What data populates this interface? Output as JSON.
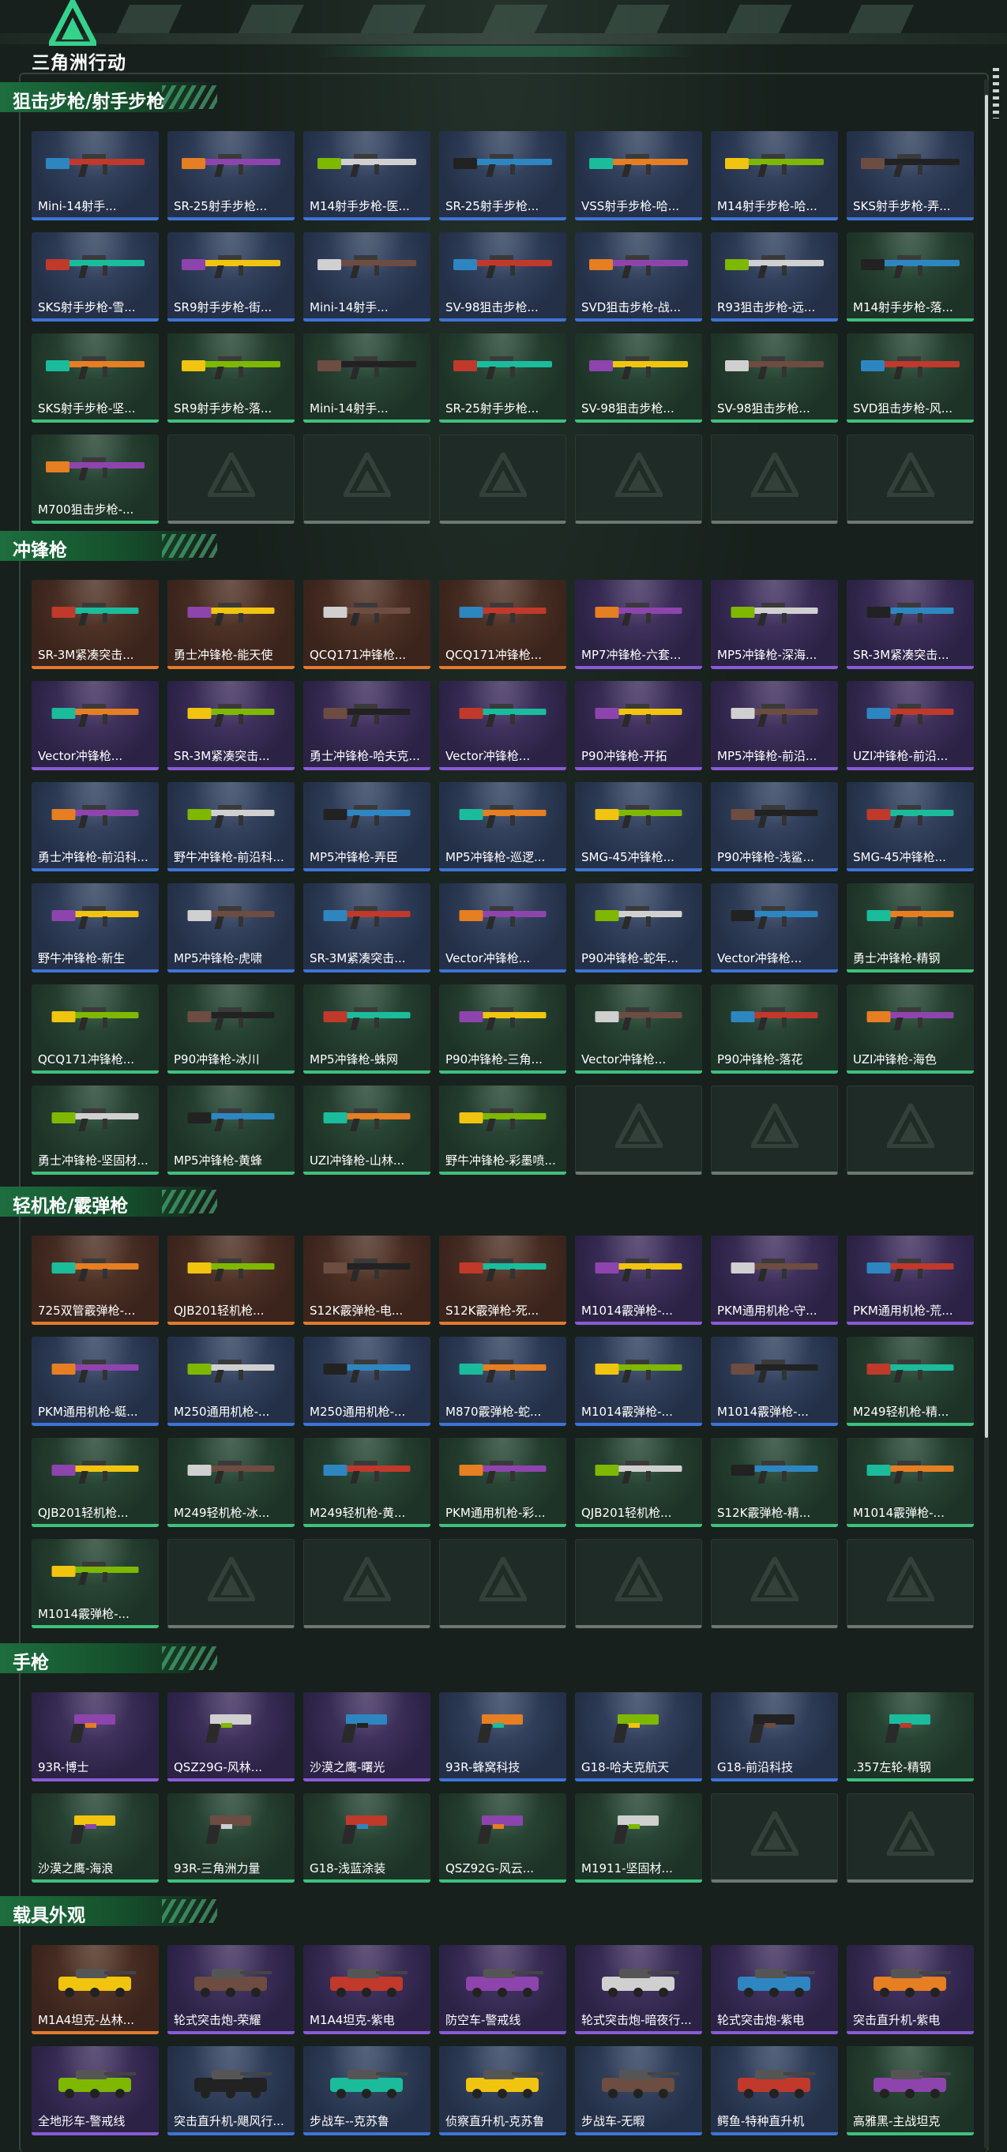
{
  "app": {
    "title": "三角洲行动"
  },
  "colors": {
    "blue": "#3e74d6",
    "purple": "#8a5ad6",
    "orange": "#e27a2e",
    "green": "#3fc07e",
    "accent": "#1d6e3e"
  },
  "categories": [
    {
      "title": "狙击步枪/射手步枪",
      "kind": "gun",
      "items": [
        {
          "label": "Mini-14射手...",
          "rarity": "blue"
        },
        {
          "label": "SR-25射手步枪...",
          "rarity": "blue"
        },
        {
          "label": "M14射手步枪-医...",
          "rarity": "blue"
        },
        {
          "label": "SR-25射手步枪...",
          "rarity": "blue"
        },
        {
          "label": "VSS射手步枪-哈...",
          "rarity": "blue"
        },
        {
          "label": "M14射手步枪-哈...",
          "rarity": "blue"
        },
        {
          "label": "SKS射手步枪-弄...",
          "rarity": "blue"
        },
        {
          "label": "SKS射手步枪-雪...",
          "rarity": "blue"
        },
        {
          "label": "SR9射手步枪-街...",
          "rarity": "blue"
        },
        {
          "label": "Mini-14射手...",
          "rarity": "blue"
        },
        {
          "label": "SV-98狙击步枪...",
          "rarity": "blue"
        },
        {
          "label": "SVD狙击步枪-战...",
          "rarity": "blue"
        },
        {
          "label": "R93狙击步枪-远...",
          "rarity": "blue"
        },
        {
          "label": "M14射手步枪-落...",
          "rarity": "green"
        },
        {
          "label": "SKS射手步枪-坚...",
          "rarity": "green"
        },
        {
          "label": "SR9射手步枪-落...",
          "rarity": "green"
        },
        {
          "label": "Mini-14射手...",
          "rarity": "green"
        },
        {
          "label": "SR-25射手步枪...",
          "rarity": "green"
        },
        {
          "label": "SV-98狙击步枪...",
          "rarity": "green"
        },
        {
          "label": "SV-98狙击步枪...",
          "rarity": "green"
        },
        {
          "label": "SVD狙击步枪-风...",
          "rarity": "green"
        },
        {
          "label": "M700狙击步枪-...",
          "rarity": "green"
        },
        {
          "label": "",
          "rarity": "empty"
        },
        {
          "label": "",
          "rarity": "empty"
        },
        {
          "label": "",
          "rarity": "empty"
        },
        {
          "label": "",
          "rarity": "empty"
        },
        {
          "label": "",
          "rarity": "empty"
        },
        {
          "label": "",
          "rarity": "empty"
        }
      ]
    },
    {
      "title": "冲锋枪",
      "kind": "smg",
      "items": [
        {
          "label": "SR-3M紧凑突击...",
          "rarity": "orange"
        },
        {
          "label": "勇士冲锋枪-能天使",
          "rarity": "orange"
        },
        {
          "label": "QCQ171冲锋枪...",
          "rarity": "orange"
        },
        {
          "label": "QCQ171冲锋枪...",
          "rarity": "orange"
        },
        {
          "label": "MP7冲锋枪-六套...",
          "rarity": "purple"
        },
        {
          "label": "MP5冲锋枪-深海...",
          "rarity": "purple"
        },
        {
          "label": "SR-3M紧凑突击...",
          "rarity": "purple"
        },
        {
          "label": "Vector冲锋枪...",
          "rarity": "purple"
        },
        {
          "label": "SR-3M紧凑突击...",
          "rarity": "purple"
        },
        {
          "label": "勇士冲锋枪-哈夫克...",
          "rarity": "purple"
        },
        {
          "label": "Vector冲锋枪...",
          "rarity": "purple"
        },
        {
          "label": "P90冲锋枪-开拓",
          "rarity": "purple"
        },
        {
          "label": "MP5冲锋枪-前沿...",
          "rarity": "purple"
        },
        {
          "label": "UZI冲锋枪-前沿...",
          "rarity": "purple"
        },
        {
          "label": "勇士冲锋枪-前沿科...",
          "rarity": "blue"
        },
        {
          "label": "野牛冲锋枪-前沿科...",
          "rarity": "blue"
        },
        {
          "label": "MP5冲锋枪-弄臣",
          "rarity": "blue"
        },
        {
          "label": "MP5冲锋枪-巡逻...",
          "rarity": "blue"
        },
        {
          "label": "SMG-45冲锋枪...",
          "rarity": "blue"
        },
        {
          "label": "P90冲锋枪-浅鲨...",
          "rarity": "blue"
        },
        {
          "label": "SMG-45冲锋枪...",
          "rarity": "blue"
        },
        {
          "label": "野牛冲锋枪-新生",
          "rarity": "blue"
        },
        {
          "label": "MP5冲锋枪-虎啸",
          "rarity": "blue"
        },
        {
          "label": "SR-3M紧凑突击...",
          "rarity": "blue"
        },
        {
          "label": "Vector冲锋枪...",
          "rarity": "blue"
        },
        {
          "label": "P90冲锋枪-蛇年...",
          "rarity": "blue"
        },
        {
          "label": "Vector冲锋枪...",
          "rarity": "blue"
        },
        {
          "label": "勇士冲锋枪-精钢",
          "rarity": "green"
        },
        {
          "label": "QCQ171冲锋枪...",
          "rarity": "green"
        },
        {
          "label": "P90冲锋枪-冰川",
          "rarity": "green"
        },
        {
          "label": "MP5冲锋枪-蛛网",
          "rarity": "green"
        },
        {
          "label": "P90冲锋枪-三角...",
          "rarity": "green"
        },
        {
          "label": "Vector冲锋枪...",
          "rarity": "green"
        },
        {
          "label": "P90冲锋枪-落花",
          "rarity": "green"
        },
        {
          "label": "UZI冲锋枪-海色",
          "rarity": "green"
        },
        {
          "label": "勇士冲锋枪-坚固材...",
          "rarity": "green"
        },
        {
          "label": "MP5冲锋枪-黄蜂",
          "rarity": "green"
        },
        {
          "label": "UZI冲锋枪-山林...",
          "rarity": "green"
        },
        {
          "label": "野牛冲锋枪-彩墨喷...",
          "rarity": "green"
        },
        {
          "label": "",
          "rarity": "empty"
        },
        {
          "label": "",
          "rarity": "empty"
        },
        {
          "label": "",
          "rarity": "empty"
        }
      ]
    },
    {
      "title": "轻机枪/霰弹枪",
      "kind": "lmg",
      "items": [
        {
          "label": "725双管霰弹枪-...",
          "rarity": "orange"
        },
        {
          "label": "QJB201轻机枪...",
          "rarity": "orange"
        },
        {
          "label": "S12K霰弹枪-电...",
          "rarity": "orange"
        },
        {
          "label": "S12K霰弹枪-死...",
          "rarity": "orange"
        },
        {
          "label": "M1014霰弹枪-...",
          "rarity": "purple"
        },
        {
          "label": "PKM通用机枪-守...",
          "rarity": "purple"
        },
        {
          "label": "PKM通用机枪-荒...",
          "rarity": "purple"
        },
        {
          "label": "PKM通用机枪-蜓...",
          "rarity": "blue"
        },
        {
          "label": "M250通用机枪-...",
          "rarity": "blue"
        },
        {
          "label": "M250通用机枪-...",
          "rarity": "blue"
        },
        {
          "label": "M870霰弹枪-蛇...",
          "rarity": "blue"
        },
        {
          "label": "M1014霰弹枪-...",
          "rarity": "blue"
        },
        {
          "label": "M1014霰弹枪-...",
          "rarity": "blue"
        },
        {
          "label": "M249轻机枪-精...",
          "rarity": "green"
        },
        {
          "label": "QJB201轻机枪...",
          "rarity": "green"
        },
        {
          "label": "M249轻机枪-冰...",
          "rarity": "green"
        },
        {
          "label": "M249轻机枪-黄...",
          "rarity": "green"
        },
        {
          "label": "PKM通用机枪-彩...",
          "rarity": "green"
        },
        {
          "label": "QJB201轻机枪...",
          "rarity": "green"
        },
        {
          "label": "S12K霰弹枪-精...",
          "rarity": "green"
        },
        {
          "label": "M1014霰弹枪-...",
          "rarity": "green"
        },
        {
          "label": "M1014霰弹枪-...",
          "rarity": "green"
        },
        {
          "label": "",
          "rarity": "empty"
        },
        {
          "label": "",
          "rarity": "empty"
        },
        {
          "label": "",
          "rarity": "empty"
        },
        {
          "label": "",
          "rarity": "empty"
        },
        {
          "label": "",
          "rarity": "empty"
        },
        {
          "label": "",
          "rarity": "empty"
        }
      ]
    },
    {
      "title": "手枪",
      "kind": "pistol",
      "items": [
        {
          "label": "93R-博士",
          "rarity": "purple"
        },
        {
          "label": "QSZ29G-风林...",
          "rarity": "purple"
        },
        {
          "label": "沙漠之鹰-曙光",
          "rarity": "purple"
        },
        {
          "label": "93R-蜂窝科技",
          "rarity": "blue"
        },
        {
          "label": "G18-哈夫克航天",
          "rarity": "blue"
        },
        {
          "label": "G18-前沿科技",
          "rarity": "blue"
        },
        {
          "label": ".357左轮-精钢",
          "rarity": "green"
        },
        {
          "label": "沙漠之鹰-海浪",
          "rarity": "green"
        },
        {
          "label": "93R-三角洲力量",
          "rarity": "green"
        },
        {
          "label": "G18-浅蓝涂装",
          "rarity": "green"
        },
        {
          "label": "QSZ92G-风云...",
          "rarity": "green"
        },
        {
          "label": "M1911-坚固材...",
          "rarity": "green"
        },
        {
          "label": "",
          "rarity": "empty"
        },
        {
          "label": "",
          "rarity": "empty"
        }
      ]
    },
    {
      "title": "载具外观",
      "kind": "vehicle",
      "items": [
        {
          "label": "M1A4坦克-丛林...",
          "rarity": "orange"
        },
        {
          "label": "轮式突击炮-荣耀",
          "rarity": "purple"
        },
        {
          "label": "M1A4坦克-紫电",
          "rarity": "purple"
        },
        {
          "label": "防空车-警戒线",
          "rarity": "purple"
        },
        {
          "label": "轮式突击炮-暗夜行...",
          "rarity": "purple"
        },
        {
          "label": "轮式突击炮-紫电",
          "rarity": "purple"
        },
        {
          "label": "突击直升机-紫电",
          "rarity": "purple"
        },
        {
          "label": "全地形车-警戒线",
          "rarity": "purple"
        },
        {
          "label": "突击直升机-飓风行...",
          "rarity": "blue"
        },
        {
          "label": "步战车--克苏鲁",
          "rarity": "blue"
        },
        {
          "label": "侦察直升机-克苏鲁",
          "rarity": "blue"
        },
        {
          "label": "步战车-无暇",
          "rarity": "blue"
        },
        {
          "label": "鳄鱼-特种直升机",
          "rarity": "blue"
        },
        {
          "label": "高雅黑-主战坦克",
          "rarity": "green"
        }
      ]
    }
  ]
}
